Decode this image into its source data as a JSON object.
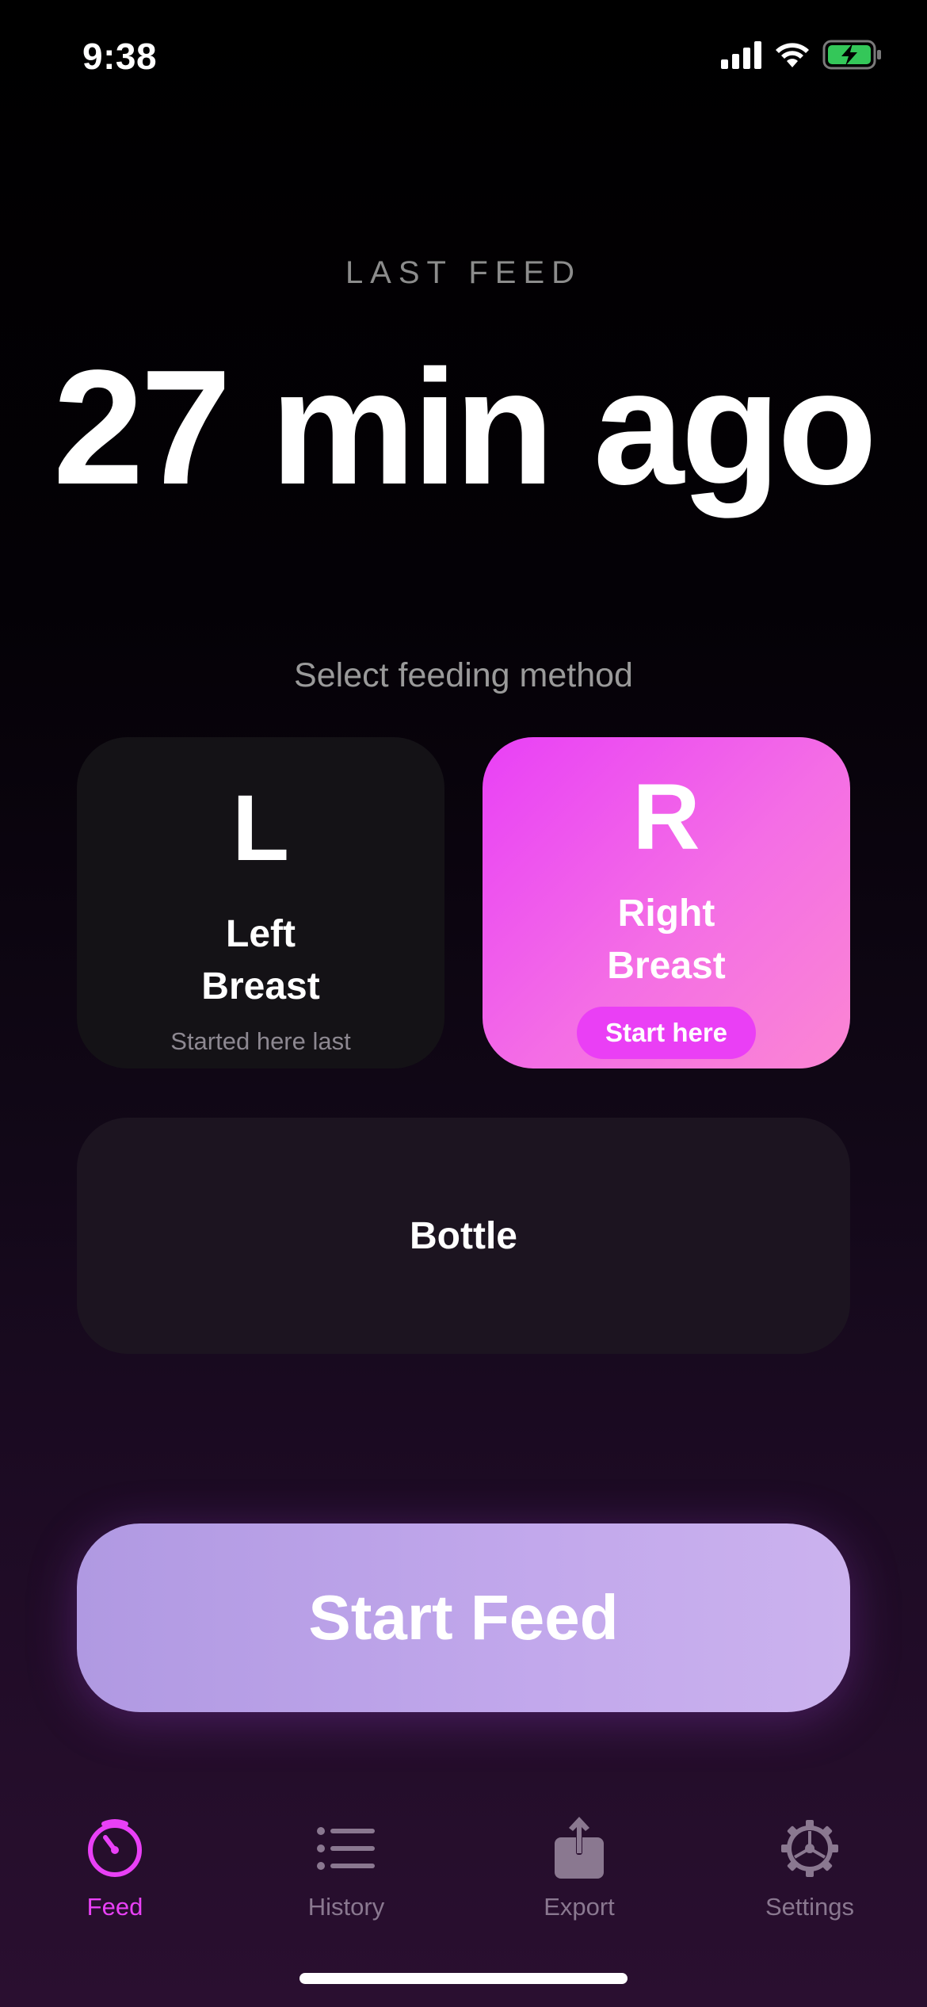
{
  "status_bar": {
    "time": "9:38"
  },
  "header": {
    "label": "LAST FEED",
    "value": "27 min ago"
  },
  "feeding": {
    "prompt": "Select feeding method",
    "left": {
      "letter": "L",
      "title_line1": "Left",
      "title_line2": "Breast",
      "note": "Started here last"
    },
    "right": {
      "letter": "R",
      "title_line1": "Right",
      "title_line2": "Breast",
      "badge": "Start here",
      "selected": true
    },
    "bottle": {
      "label": "Bottle"
    }
  },
  "start_button": {
    "label": "Start Feed"
  },
  "tabs": [
    {
      "label": "Feed",
      "icon": "timer-icon",
      "active": true
    },
    {
      "label": "History",
      "icon": "list-icon",
      "active": false
    },
    {
      "label": "Export",
      "icon": "share-icon",
      "active": false
    },
    {
      "label": "Settings",
      "icon": "gear-icon",
      "active": false
    }
  ],
  "colors": {
    "accent": "#e940f6",
    "inactive_tab": "#8a7890",
    "start_button": "#c2a8ec"
  }
}
